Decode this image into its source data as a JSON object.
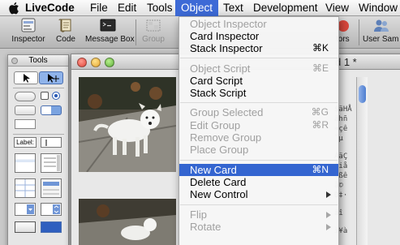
{
  "menubar": {
    "app": "LiveCode",
    "items": [
      "File",
      "Edit",
      "Tools",
      "Object",
      "Text",
      "Development",
      "View",
      "Window"
    ],
    "active": "Object"
  },
  "toolbar": {
    "items": [
      {
        "label": "Inspector",
        "icon": "inspector-icon",
        "enabled": true
      },
      {
        "label": "Code",
        "icon": "code-script-icon",
        "enabled": true
      },
      {
        "label": "Message Box",
        "icon": "message-box-icon",
        "enabled": true
      },
      {
        "label": "Group",
        "icon": "group-icon",
        "enabled": false
      }
    ],
    "right_items": [
      {
        "label": "tors",
        "icon": "errors-icon"
      },
      {
        "label": "User Sam",
        "icon": "user-samples-icon"
      }
    ]
  },
  "tools_palette": {
    "title": "Tools",
    "label_widget": "Label:"
  },
  "stack_window": {
    "title_suffix": "d 1 *",
    "side_text": [
      "$äHÅ",
      "ähñ",
      "≈çê",
      "¨µ",
      "ÀäÇ",
      "Åiå",
      "îßê",
      "ã©",
      "Ð‡·",
      "äî",
      "ì¥à"
    ]
  },
  "object_menu": {
    "items": [
      {
        "label": "Object Inspector",
        "shortcut": "",
        "enabled": false,
        "selected": false,
        "submenu": false
      },
      {
        "label": "Card Inspector",
        "shortcut": "",
        "enabled": true,
        "selected": false,
        "submenu": false
      },
      {
        "label": "Stack Inspector",
        "shortcut": "⌘K",
        "enabled": true,
        "selected": false,
        "submenu": false
      },
      {
        "label": "Object Script",
        "shortcut": "⌘E",
        "enabled": false,
        "selected": false,
        "submenu": false
      },
      {
        "label": "Card Script",
        "shortcut": "",
        "enabled": true,
        "selected": false,
        "submenu": false
      },
      {
        "label": "Stack Script",
        "shortcut": "",
        "enabled": true,
        "selected": false,
        "submenu": false
      },
      {
        "label": "Group Selected",
        "shortcut": "⌘G",
        "enabled": false,
        "selected": false,
        "submenu": false
      },
      {
        "label": "Edit Group",
        "shortcut": "⌘R",
        "enabled": false,
        "selected": false,
        "submenu": false
      },
      {
        "label": "Remove Group",
        "shortcut": "",
        "enabled": false,
        "selected": false,
        "submenu": false
      },
      {
        "label": "Place Group",
        "shortcut": "",
        "enabled": false,
        "selected": false,
        "submenu": false
      },
      {
        "label": "New Card",
        "shortcut": "⌘N",
        "enabled": true,
        "selected": true,
        "submenu": false
      },
      {
        "label": "Delete Card",
        "shortcut": "",
        "enabled": true,
        "selected": false,
        "submenu": false
      },
      {
        "label": "New Control",
        "shortcut": "",
        "enabled": true,
        "selected": false,
        "submenu": true
      },
      {
        "label": "Flip",
        "shortcut": "",
        "enabled": false,
        "selected": false,
        "submenu": true
      },
      {
        "label": "Rotate",
        "shortcut": "",
        "enabled": false,
        "selected": false,
        "submenu": true
      }
    ]
  },
  "colors": {
    "menu_highlight": "#3465d0",
    "menubar_active": "#3d6ad6",
    "disabled_text": "#a0a0a0"
  }
}
